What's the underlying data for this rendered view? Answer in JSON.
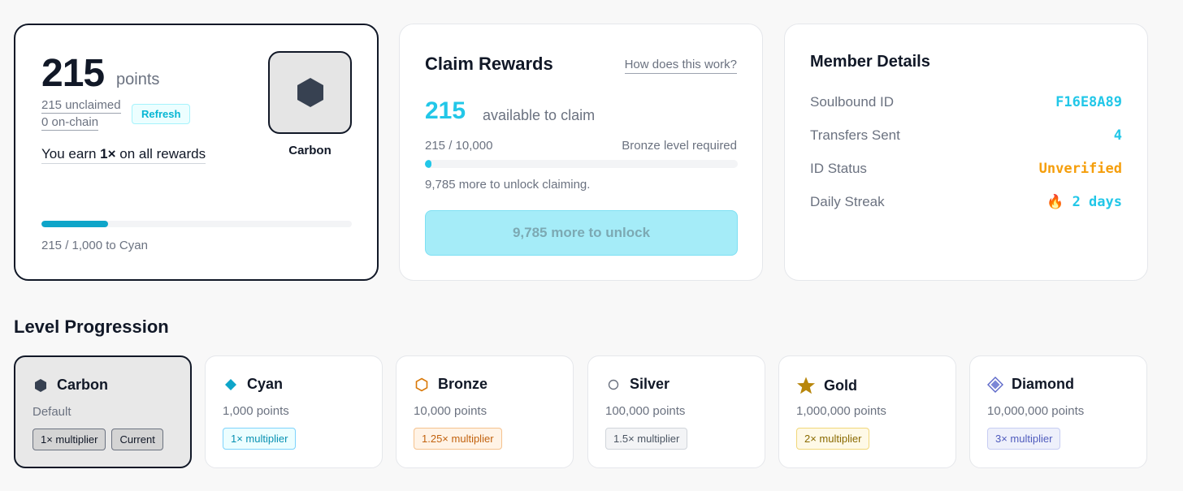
{
  "points_card": {
    "points": "215",
    "points_label": "points",
    "unclaimed": "215 unclaimed",
    "on_chain": "0 on-chain",
    "refresh_label": "Refresh",
    "earn_prefix": "You earn ",
    "earn_multiplier": "1×",
    "earn_suffix": " on all rewards",
    "tier_name": "Carbon",
    "tier_icon": "carbon-hexagon-icon",
    "progress_fraction": 0.215,
    "progress_caption": "215 / 1,000 to Cyan"
  },
  "claim_card": {
    "title": "Claim Rewards",
    "help_link": "How does this work?",
    "available": "215",
    "available_label": "available to claim",
    "ratio": "215 / 10,000",
    "requirement": "Bronze level required",
    "progress_fraction": 0.0215,
    "note": "9,785 more to unlock claiming.",
    "button_label": "9,785 more to unlock"
  },
  "member_card": {
    "title": "Member Details",
    "rows": [
      {
        "label": "Soulbound ID",
        "value": "F16E8A89",
        "color": "#22c7e8"
      },
      {
        "label": "Transfers Sent",
        "value": "4",
        "color": "#22c7e8"
      },
      {
        "label": "ID Status",
        "value": "Unverified",
        "color": "#f59e0b"
      },
      {
        "label": "Daily Streak",
        "value": "🔥 2 days",
        "color": "#22c7e8"
      }
    ]
  },
  "levels": {
    "title": "Level Progression",
    "items": [
      {
        "name": "Carbon",
        "points": "Default",
        "icon": "carbon-hexagon-icon",
        "multiplier": "1× multiplier",
        "current_label": "Current",
        "badge_bg": "#d4d4d4",
        "badge_border": "#6b7280",
        "badge_color": "#111827"
      },
      {
        "name": "Cyan",
        "points": "1,000 points",
        "icon": "cyan-diamond-icon",
        "multiplier": "1× multiplier",
        "badge_bg": "#ecfeff",
        "badge_border": "#7dd3fc",
        "badge_color": "#0891b2"
      },
      {
        "name": "Bronze",
        "points": "10,000 points",
        "icon": "bronze-hexagon-icon",
        "multiplier": "1.25× multiplier",
        "badge_bg": "#fff3e6",
        "badge_border": "#f5c28e",
        "badge_color": "#c2620e"
      },
      {
        "name": "Silver",
        "points": "100,000 points",
        "icon": "silver-circle-icon",
        "multiplier": "1.5× multiplier",
        "badge_bg": "#f3f4f6",
        "badge_border": "#d1d5db",
        "badge_color": "#4b5563"
      },
      {
        "name": "Gold",
        "points": "1,000,000 points",
        "icon": "gold-star-icon",
        "multiplier": "2× multiplier",
        "badge_bg": "#fef9e7",
        "badge_border": "#f1d77a",
        "badge_color": "#8a6a00"
      },
      {
        "name": "Diamond",
        "points": "10,000,000 points",
        "icon": "diamond-gem-icon",
        "multiplier": "3× multiplier",
        "badge_bg": "#eef0fb",
        "badge_border": "#c7cdf3",
        "badge_color": "#4f5bbd"
      }
    ]
  },
  "colors": {
    "accent": "#22c7e8",
    "progress_fill": "#0ea5c9",
    "warning": "#f59e0b"
  }
}
